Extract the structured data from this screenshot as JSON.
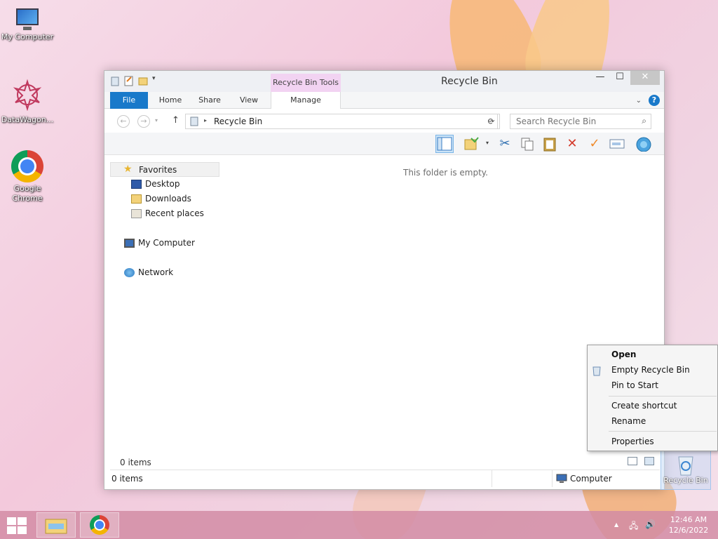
{
  "desktop": {
    "icons": [
      {
        "label": "My Computer"
      },
      {
        "label": "DataWagon..."
      },
      {
        "label": "Google Chrome"
      }
    ],
    "recycle_bin_label": "Recycle Bin"
  },
  "window": {
    "title": "Recycle Bin",
    "ribbon": {
      "contextual_group": "Recycle Bin Tools",
      "tabs": {
        "file": "File",
        "home": "Home",
        "share": "Share",
        "view": "View",
        "manage": "Manage"
      }
    },
    "controls": {
      "minimize": "—",
      "maximize": "☐",
      "close": "✕"
    },
    "address": {
      "path": "Recycle Bin",
      "search_placeholder": "Search Recycle Bin"
    },
    "nav_pane": {
      "favorites": "Favorites",
      "desktop": "Desktop",
      "downloads": "Downloads",
      "recent": "Recent places",
      "computer": "My Computer",
      "network": "Network"
    },
    "empty_message": "This folder is empty.",
    "item_count": "0 items",
    "status": {
      "left": "0 items",
      "right": "Computer"
    }
  },
  "context_menu": {
    "open": "Open",
    "empty": "Empty Recycle Bin",
    "pin": "Pin to Start",
    "shortcut": "Create shortcut",
    "rename": "Rename",
    "properties": "Properties"
  },
  "taskbar": {
    "time": "12:46 AM",
    "date": "12/6/2022"
  },
  "colors": {
    "accent": "#1979ca",
    "contextual_tab": "#f2d3f2",
    "taskbar": "#d28ca5"
  }
}
